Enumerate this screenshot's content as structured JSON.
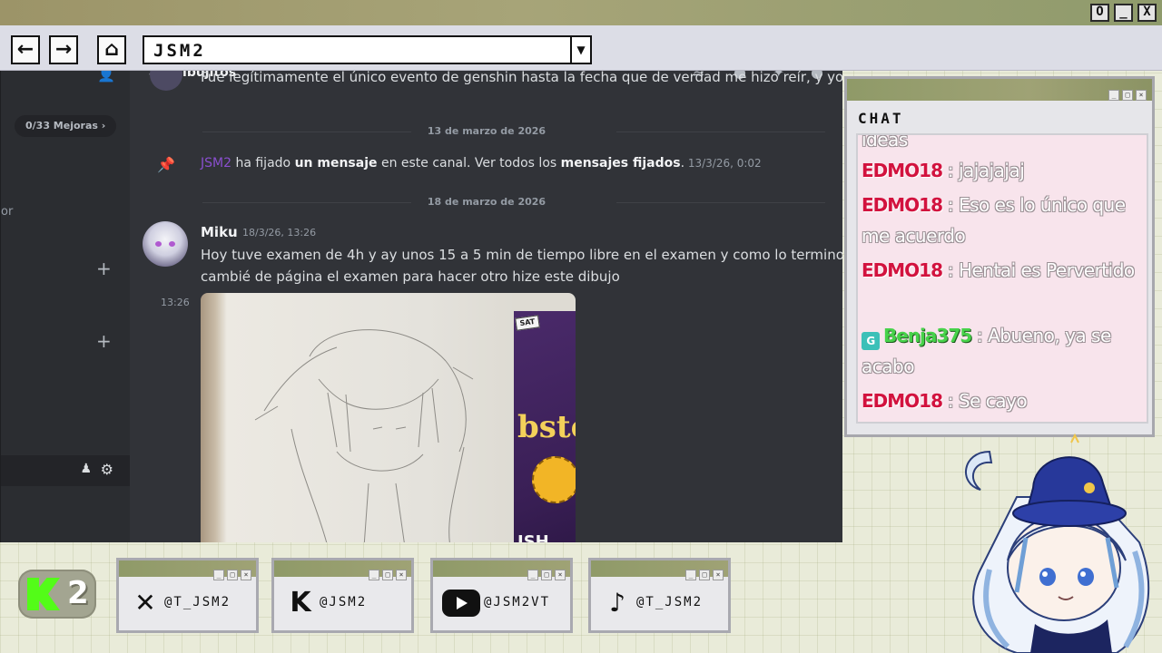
{
  "window": {
    "controls": [
      "O",
      "_",
      "X"
    ]
  },
  "toolbar": {
    "back_icon": "arrow-left-icon",
    "forward_icon": "arrow-right-icon",
    "home_icon": "home-icon",
    "address": "JSM2"
  },
  "discord": {
    "channel_name": "dibujitos",
    "sidebar": {
      "boosts": "0/33 Mejoras",
      "partial_label": "or"
    },
    "messages": {
      "cut_line": "Fue legítimamente el único evento de genshin hasta la fecha que de verdad me hizo reír, y yo me",
      "date1": "13 de marzo de 2026",
      "pin": {
        "user": "JSM2",
        "text1": " ha fijado ",
        "bold1": "un mensaje",
        "text2": " en este canal. Ver todos los ",
        "bold2": "mensajes fijados",
        "text3": ".",
        "time": " 13/3/26, 0:02"
      },
      "date2": "18 de marzo de 2026",
      "author": "Miku",
      "timestamp": "18/3/26, 13:26",
      "line1": "Hoy tuve examen de 4h y ay unos 15 a 5 min de tiempo libre en el examen y como lo termino rápido",
      "line2": "cambié de página el examen para hacer otro hize este dibujo",
      "row_time": "13:26",
      "book_sat": "SAT",
      "book_title": "bster",
      "book_ish": "ISH"
    }
  },
  "chat": {
    "title": "CHAT",
    "partial_top": "ideas",
    "messages": [
      {
        "user": "EDMO18",
        "text": " : jajajajaj"
      },
      {
        "user": "EDMO18",
        "text": " : Eso es lo único que me acuerdo"
      },
      {
        "user": "EDMO18",
        "text": " : Hentai es Pervertido"
      },
      {
        "user": "Benja375",
        "text": " : Abueno, ya se acabo"
      },
      {
        "user": "EDMO18",
        "text": " : Se cayo"
      }
    ]
  },
  "social": {
    "kick_count": "2",
    "cards": [
      {
        "icon": "x-icon",
        "glyph": "✕",
        "handle": "@T_JSM2"
      },
      {
        "icon": "kick-icon",
        "glyph": "K",
        "handle": "@JSM2"
      },
      {
        "icon": "youtube-icon",
        "glyph": "",
        "handle": "@JSM2VT"
      },
      {
        "icon": "tiktok-icon",
        "glyph": "♪",
        "handle": "@T_JSM2"
      }
    ]
  },
  "colors": {
    "chat_user": "#d2123e",
    "chat_user_alt": "#47d24a",
    "discord_bg": "#313338",
    "kick_green": "#53fc18"
  }
}
